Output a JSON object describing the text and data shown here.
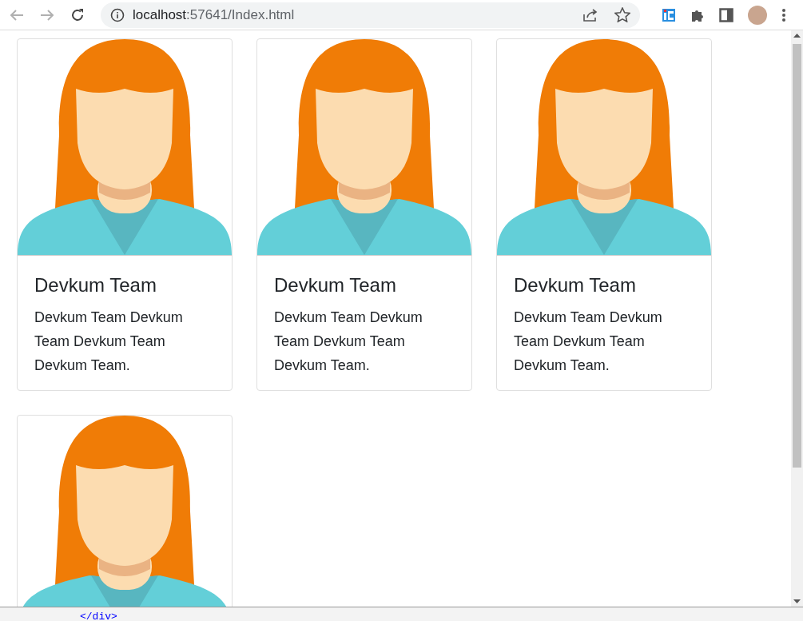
{
  "browser": {
    "url_host": "localhost",
    "url_rest": ":57641/Index.html"
  },
  "cards": [
    {
      "kind": "full",
      "title": "Devkum Team",
      "text": "Devkum Team Devkum Team Devkum Team Devkum Team."
    },
    {
      "kind": "full",
      "title": "Devkum Team",
      "text": "Devkum Team Devkum Team Devkum Team Devkum Team."
    },
    {
      "kind": "full",
      "title": "Devkum Team",
      "text": "Devkum Team Devkum Team Devkum Team Devkum Team."
    },
    {
      "kind": "image_only"
    }
  ],
  "code_strip": {
    "text": "</div>"
  }
}
